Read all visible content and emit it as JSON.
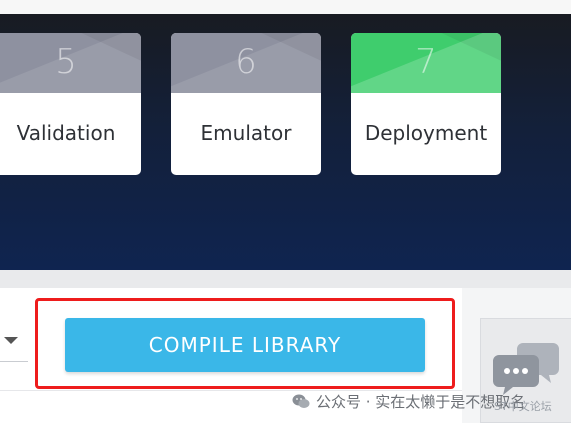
{
  "steps": [
    {
      "number": "5",
      "label": "Validation",
      "state": "inactive"
    },
    {
      "number": "6",
      "label": "Emulator",
      "state": "inactive"
    },
    {
      "number": "7",
      "label": "Deployment",
      "state": "active"
    }
  ],
  "actions": {
    "compile_label": "COMPILE LIBRARY"
  },
  "watermark": {
    "text": "公众号 · 实在太懒于是不想取名",
    "sub": "ST中文论坛"
  },
  "colors": {
    "active_step": "#3fcd6d",
    "inactive_step": "#8e91a0",
    "compile_button": "#3ab7e8",
    "highlight": "#ee1c1c",
    "hero_background": "#0f2450"
  },
  "icons": {
    "dropdown": "chevron-down-icon",
    "chat": "chat-bubbles-icon",
    "wechat": "wechat-icon"
  }
}
